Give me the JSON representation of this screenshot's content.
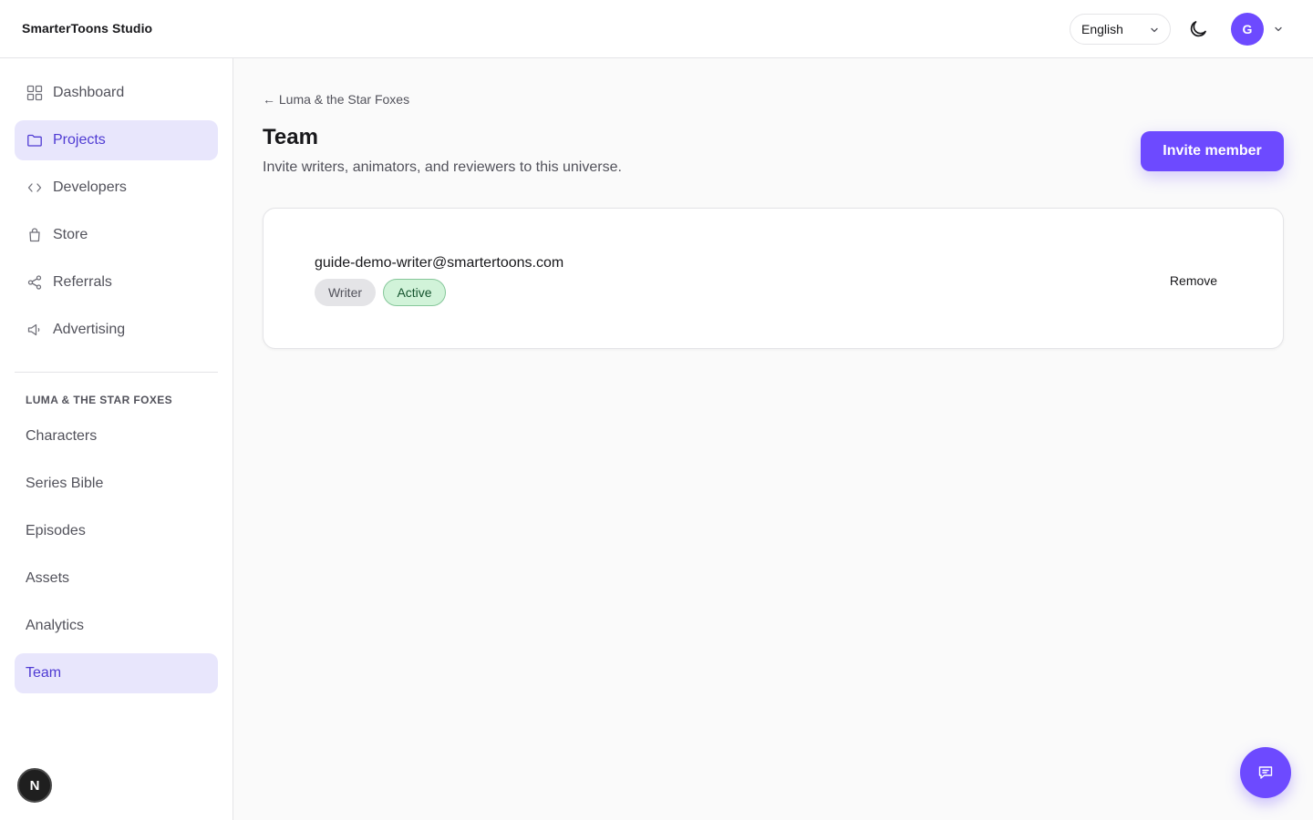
{
  "header": {
    "brand": "SmarterToons Studio",
    "language": "English",
    "avatar_initial": "G"
  },
  "sidebar": {
    "nav": [
      {
        "label": "Dashboard",
        "icon": "grid-icon"
      },
      {
        "label": "Projects",
        "icon": "folder-icon",
        "active": true
      },
      {
        "label": "Developers",
        "icon": "code-icon"
      },
      {
        "label": "Store",
        "icon": "shopping-bag-icon"
      },
      {
        "label": "Referrals",
        "icon": "share-icon"
      },
      {
        "label": "Advertising",
        "icon": "megaphone-icon"
      }
    ],
    "section_label": "LUMA & THE STAR FOXES",
    "sub": [
      {
        "label": "Characters"
      },
      {
        "label": "Series Bible"
      },
      {
        "label": "Episodes"
      },
      {
        "label": "Assets"
      },
      {
        "label": "Analytics"
      },
      {
        "label": "Team",
        "active": true
      }
    ],
    "dev_badge": "N"
  },
  "main": {
    "back_link": "← Luma & the Star Foxes",
    "title": "Team",
    "subtitle": "Invite writers, animators, and reviewers to this universe.",
    "invite_label": "Invite member",
    "members": [
      {
        "email": "guide-demo-writer@smartertoons.com",
        "role": "Writer",
        "status": "Active",
        "remove_label": "Remove"
      }
    ]
  },
  "colors": {
    "accent": "#6d4aff",
    "active_bg": "#e8e6fc",
    "active_text": "#4f3bd3",
    "status_active_bg": "#d1f3d9"
  }
}
